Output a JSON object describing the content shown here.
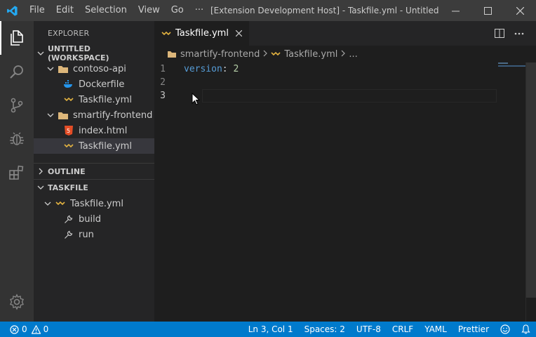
{
  "menu": [
    "File",
    "Edit",
    "Selection",
    "View",
    "Go",
    "···"
  ],
  "window_title": "[Extension Development Host] - Taskfile.yml - Untitled (...",
  "explorer": {
    "title": "EXPLORER",
    "workspace_header": "UNTITLED (WORKSPACE)",
    "folders": [
      {
        "name": "contoso-api",
        "files": [
          "Dockerfile",
          "Taskfile.yml"
        ]
      },
      {
        "name": "smartify-frontend",
        "files": [
          "index.html",
          "Taskfile.yml"
        ]
      }
    ]
  },
  "outline_header": "OUTLINE",
  "taskfile_header": "TASKFILE",
  "taskfile_tree": {
    "file": "Taskfile.yml",
    "tasks": [
      "build",
      "run"
    ]
  },
  "tab": {
    "label": "Taskfile.yml"
  },
  "breadcrumb": {
    "folder": "smartify-frontend",
    "file": "Taskfile.yml",
    "more": "..."
  },
  "code": {
    "line_numbers": [
      "1",
      "2",
      "3"
    ],
    "line1_key": "version",
    "line1_colon": ":",
    "line1_value": "2"
  },
  "status": {
    "errors": "0",
    "warnings": "0",
    "position": "Ln 3, Col 1",
    "spaces": "Spaces: 2",
    "encoding": "UTF-8",
    "eol": "CRLF",
    "language": "YAML",
    "formatter": "Prettier"
  },
  "colors": {
    "accent": "#007acc",
    "activity_bar": "#333333",
    "sidebar": "#252526",
    "editor": "#1e1e1e"
  }
}
